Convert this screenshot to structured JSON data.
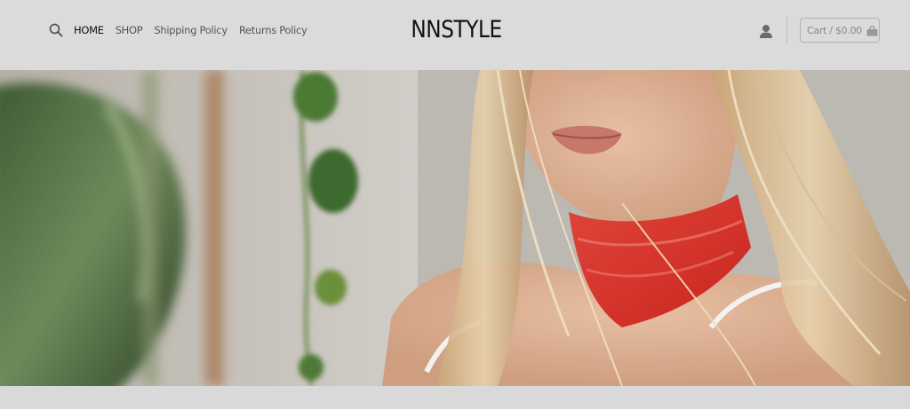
{
  "header": {
    "brand": "NNSTYLE",
    "nav": {
      "home": "HOME",
      "shop": "SHOP",
      "shipping": "Shipping Policy",
      "returns": "Returns Policy"
    },
    "cart_label": "Cart / $0.00"
  },
  "icons": {
    "search": "search-icon",
    "user": "user-icon",
    "bag": "shopping-bag-icon"
  },
  "colors": {
    "header_bg": "#dbdbdb",
    "text_dark": "#111111",
    "nav_text": "#555555",
    "cart_border": "#b3b3b3"
  }
}
